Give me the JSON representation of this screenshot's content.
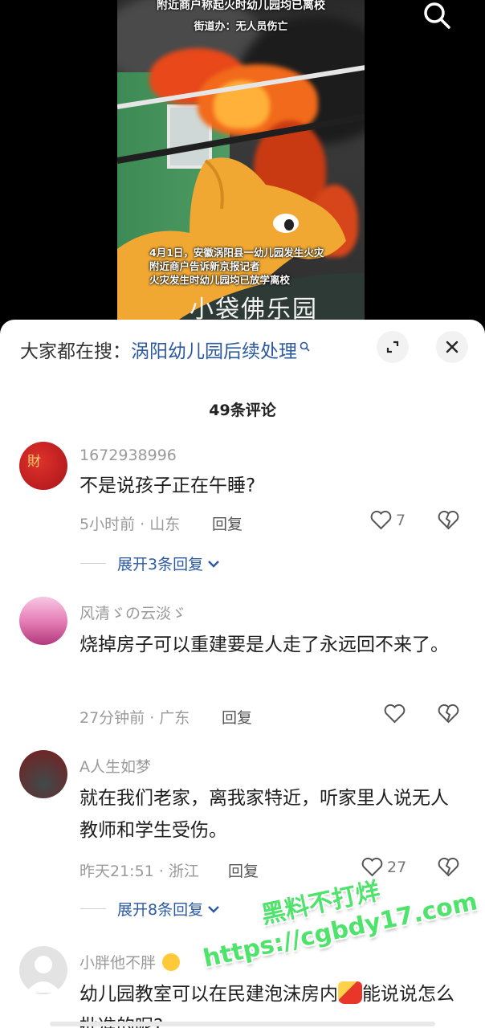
{
  "video": {
    "caption_top_1": "附近商户称起火时幼儿园均已离校",
    "caption_top_2": "街道办：无人员伤亡",
    "caption_bottom": [
      "4月1日，安徽涡阳县一幼儿园发生火灾",
      "附近商户告诉新京报记者",
      "火灾发生时幼儿园均已放学离校"
    ],
    "sign_text": "小袋佛乐园"
  },
  "header": {
    "search_prefix": "大家都在搜：",
    "search_term": "涡阳幼儿园后续处理",
    "expand_icon": "expand-icon",
    "close_icon": "close-icon"
  },
  "comment_count": "49条评论",
  "comments": [
    {
      "user": "1672938996",
      "text": "不是说孩子正在午睡?",
      "meta": "5小时前 · 山东",
      "reply": "回复",
      "likes": "7",
      "expand": "展开3条回复"
    },
    {
      "user": "风清ゞの云淡ゞ",
      "text": "烧掉房子可以重建要是人走了永远回不来了。",
      "meta": "27分钟前 · 广东",
      "reply": "回复",
      "likes": ""
    },
    {
      "user": "A人生如梦",
      "text": "就在我们老家，离我家特近，听家里人说无人教师和学生受伤。",
      "meta": "昨天21:51 · 浙江",
      "reply": "回复",
      "likes": "27",
      "expand": "展开8条回复"
    },
    {
      "user": "小胖他不胖",
      "text": "幼儿园教室可以在民建泡沫房内",
      "text_after_emoji": "能说说怎么批准的呢?",
      "meta": "",
      "reply": ""
    }
  ],
  "watermark": {
    "line1": "黑料不打烊",
    "line2": "https://cgbdy17.com"
  },
  "colors": {
    "link": "#2c5aa0",
    "meta": "#9a9a9a",
    "watermark": "#4ee36a"
  }
}
